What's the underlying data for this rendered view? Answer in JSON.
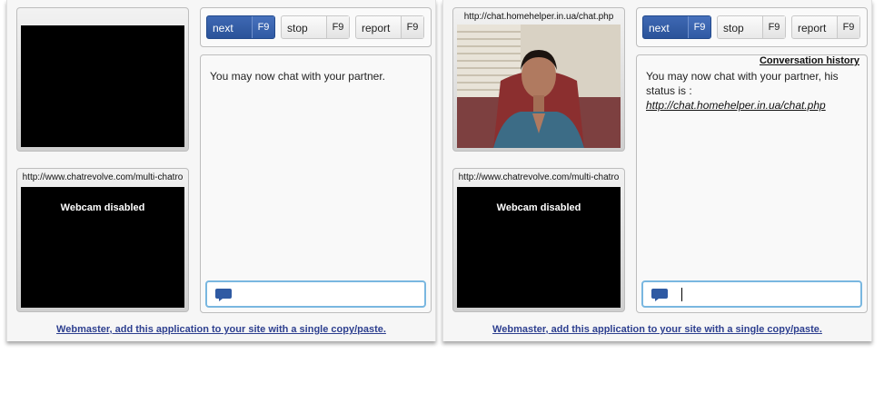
{
  "panels": [
    {
      "top_cam": {
        "url": ""
      },
      "bottom_cam": {
        "url": "http://www.chatrevolve.com/multi-chatro",
        "status": "Webcam disabled"
      },
      "toolbar": {
        "next_label": "next",
        "next_key": "F9",
        "stop_label": "stop",
        "stop_key": "F9",
        "report_label": "report",
        "report_key": "F9"
      },
      "chat": {
        "history_label": "",
        "message": "You may now chat with your partner.",
        "link": "",
        "input_value": ""
      },
      "footer": "Webmaster, add this application to your site with a single copy/paste."
    },
    {
      "top_cam": {
        "url": "http://chat.homehelper.in.ua/chat.php"
      },
      "bottom_cam": {
        "url": "http://www.chatrevolve.com/multi-chatro",
        "status": "Webcam disabled"
      },
      "toolbar": {
        "next_label": "next",
        "next_key": "F9",
        "stop_label": "stop",
        "stop_key": "F9",
        "report_label": "report",
        "report_key": "F9"
      },
      "chat": {
        "history_label": "Conversation history",
        "message": "You may now chat with your partner, his status is :",
        "link": "http://chat.homehelper.in.ua/chat.php",
        "input_value": ""
      },
      "footer": "Webmaster, add this application to your site with a single copy/paste."
    }
  ],
  "colors": {
    "accent": "#2f5aa3",
    "input_border": "#79b7e0",
    "footer_link": "#2d3f8f"
  },
  "icons": [
    "chat-bubble-icon"
  ]
}
